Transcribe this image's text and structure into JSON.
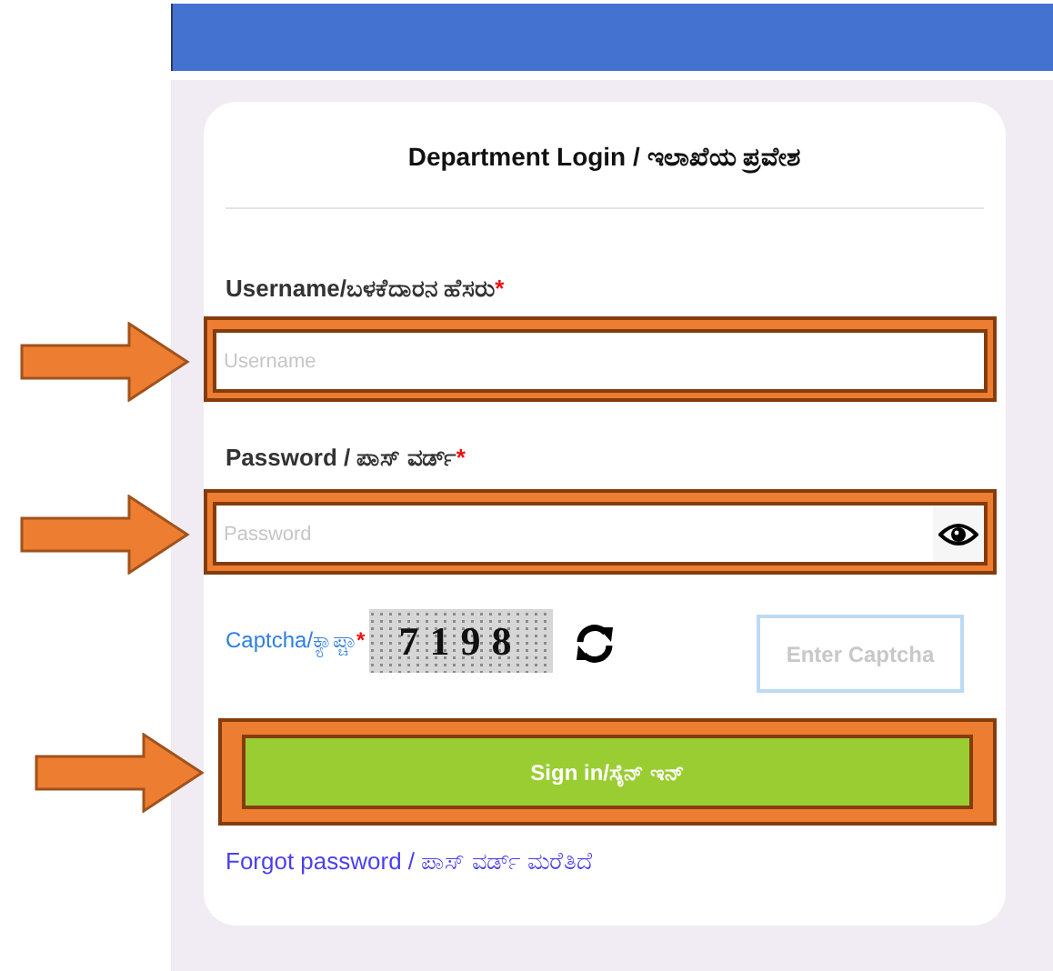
{
  "title": "Department Login / ಇಲಾಖೆಯ ಪ್ರವೇಶ",
  "fields": [
    {
      "label": "Username/ಬಳಕೆದಾರನ ಹೆಸರು",
      "required_mark": "*",
      "placeholder": "Username",
      "highlighted": true,
      "kind": "text"
    },
    {
      "label": "Password / ಪಾಸ್ ವರ್ಡ್",
      "required_mark": "*",
      "placeholder": "Password",
      "highlighted": true,
      "kind": "password"
    }
  ],
  "captcha": {
    "label": "Captcha/ಕ್ಯಾಪ್ಚಾ",
    "required_mark": "*",
    "code": "7198",
    "placeholder": "Enter Captcha"
  },
  "sign_in": {
    "label": "Sign in/ಸೈನ್ ಇನ್",
    "highlighted": true
  },
  "forgot_link": "Forgot password / ಪಾಸ್ ವರ್ಡ್ ಮರೆತಿದೆ"
}
